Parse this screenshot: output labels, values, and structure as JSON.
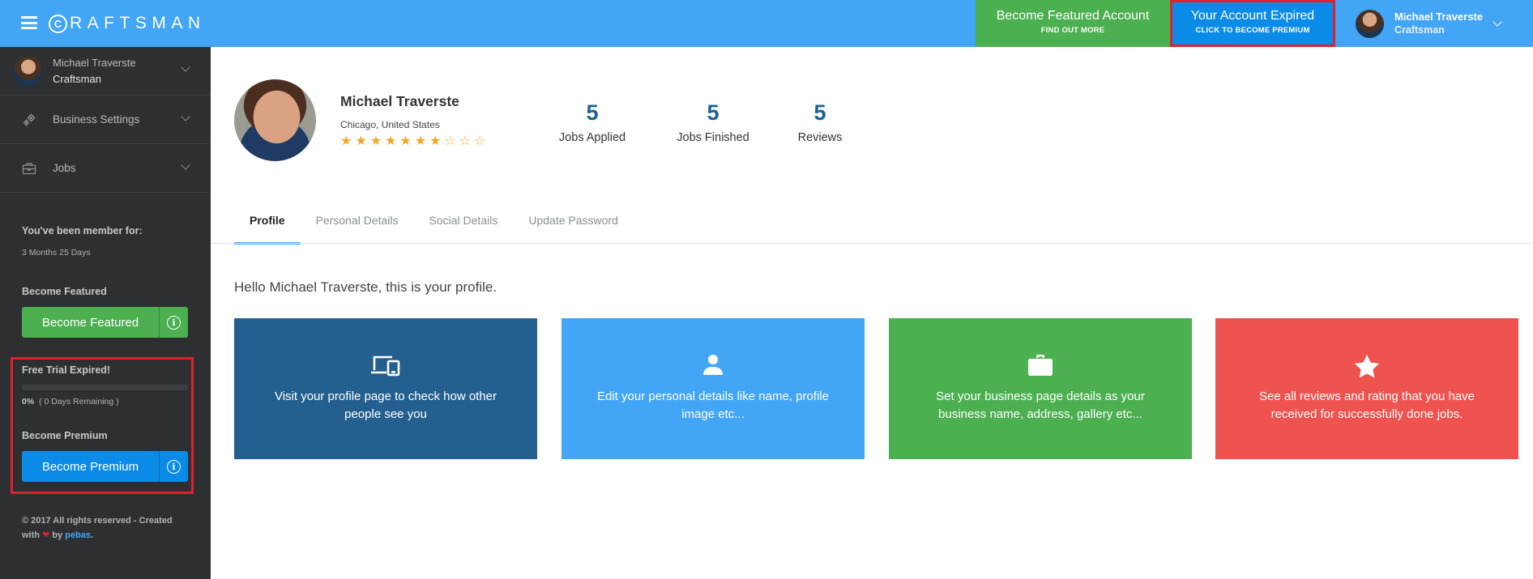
{
  "brand": {
    "name": "RAFTSMAN",
    "mark": "C"
  },
  "header": {
    "featured": {
      "title": "Become Featured Account",
      "subtitle": "FIND OUT MORE"
    },
    "expired": {
      "title": "Your Account Expired",
      "subtitle": "CLICK TO BECOME PREMIUM"
    },
    "user": {
      "name": "Michael Traverste",
      "role": "Craftsman"
    }
  },
  "sidebar": {
    "user": {
      "name": "Michael Traverste",
      "role": "Craftsman"
    },
    "items": [
      {
        "label": "Business Settings",
        "icon": "gears-icon"
      },
      {
        "label": "Jobs",
        "icon": "briefcase-icon"
      }
    ],
    "member": {
      "title": "You've been member for:",
      "value": "3 Months 25 Days"
    },
    "featured": {
      "title": "Become Featured",
      "button": "Become Featured"
    },
    "trial": {
      "title": "Free Trial Expired!",
      "percent_label": "0%",
      "remaining": "( 0 Days Remaining )",
      "progress": 0
    },
    "premium": {
      "title": "Become Premium",
      "button": "Become Premium"
    },
    "footer": {
      "text_before": "© 2017 All rights reserved - Created with",
      "text_by": "by",
      "link": "pebas",
      "text_after": "."
    }
  },
  "profile": {
    "name": "Michael Traverste",
    "location": "Chicago, United States",
    "rating": {
      "filled": 7,
      "total": 10
    },
    "stats": [
      {
        "value": "5",
        "label": "Jobs Applied"
      },
      {
        "value": "5",
        "label": "Jobs Finished"
      },
      {
        "value": "5",
        "label": "Reviews"
      }
    ]
  },
  "tabs": [
    {
      "label": "Profile",
      "active": true
    },
    {
      "label": "Personal Details",
      "active": false
    },
    {
      "label": "Social Details",
      "active": false
    },
    {
      "label": "Update Password",
      "active": false
    }
  ],
  "main": {
    "greeting": "Hello Michael Traverste, this is your profile.",
    "cards": [
      {
        "icon": "devices-icon",
        "text": "Visit your profile page to check how other people see you",
        "color": "#24608f"
      },
      {
        "icon": "user-icon",
        "text": "Edit your personal details like name, profile image etc...",
        "color": "#42a5f5"
      },
      {
        "icon": "briefcase-icon",
        "text": "Set your business page details as your business name, address, gallery etc...",
        "color": "#4caf50"
      },
      {
        "icon": "star-icon",
        "text": "See all reviews and rating that you have received for successfully done jobs.",
        "color": "#ef5350"
      }
    ]
  },
  "colors": {
    "primary": "#42a5f5",
    "success": "#4caf50",
    "danger": "#ef5350",
    "dark": "#24608f",
    "sidebar": "#2d2f31",
    "highlight": "#e0202e"
  }
}
